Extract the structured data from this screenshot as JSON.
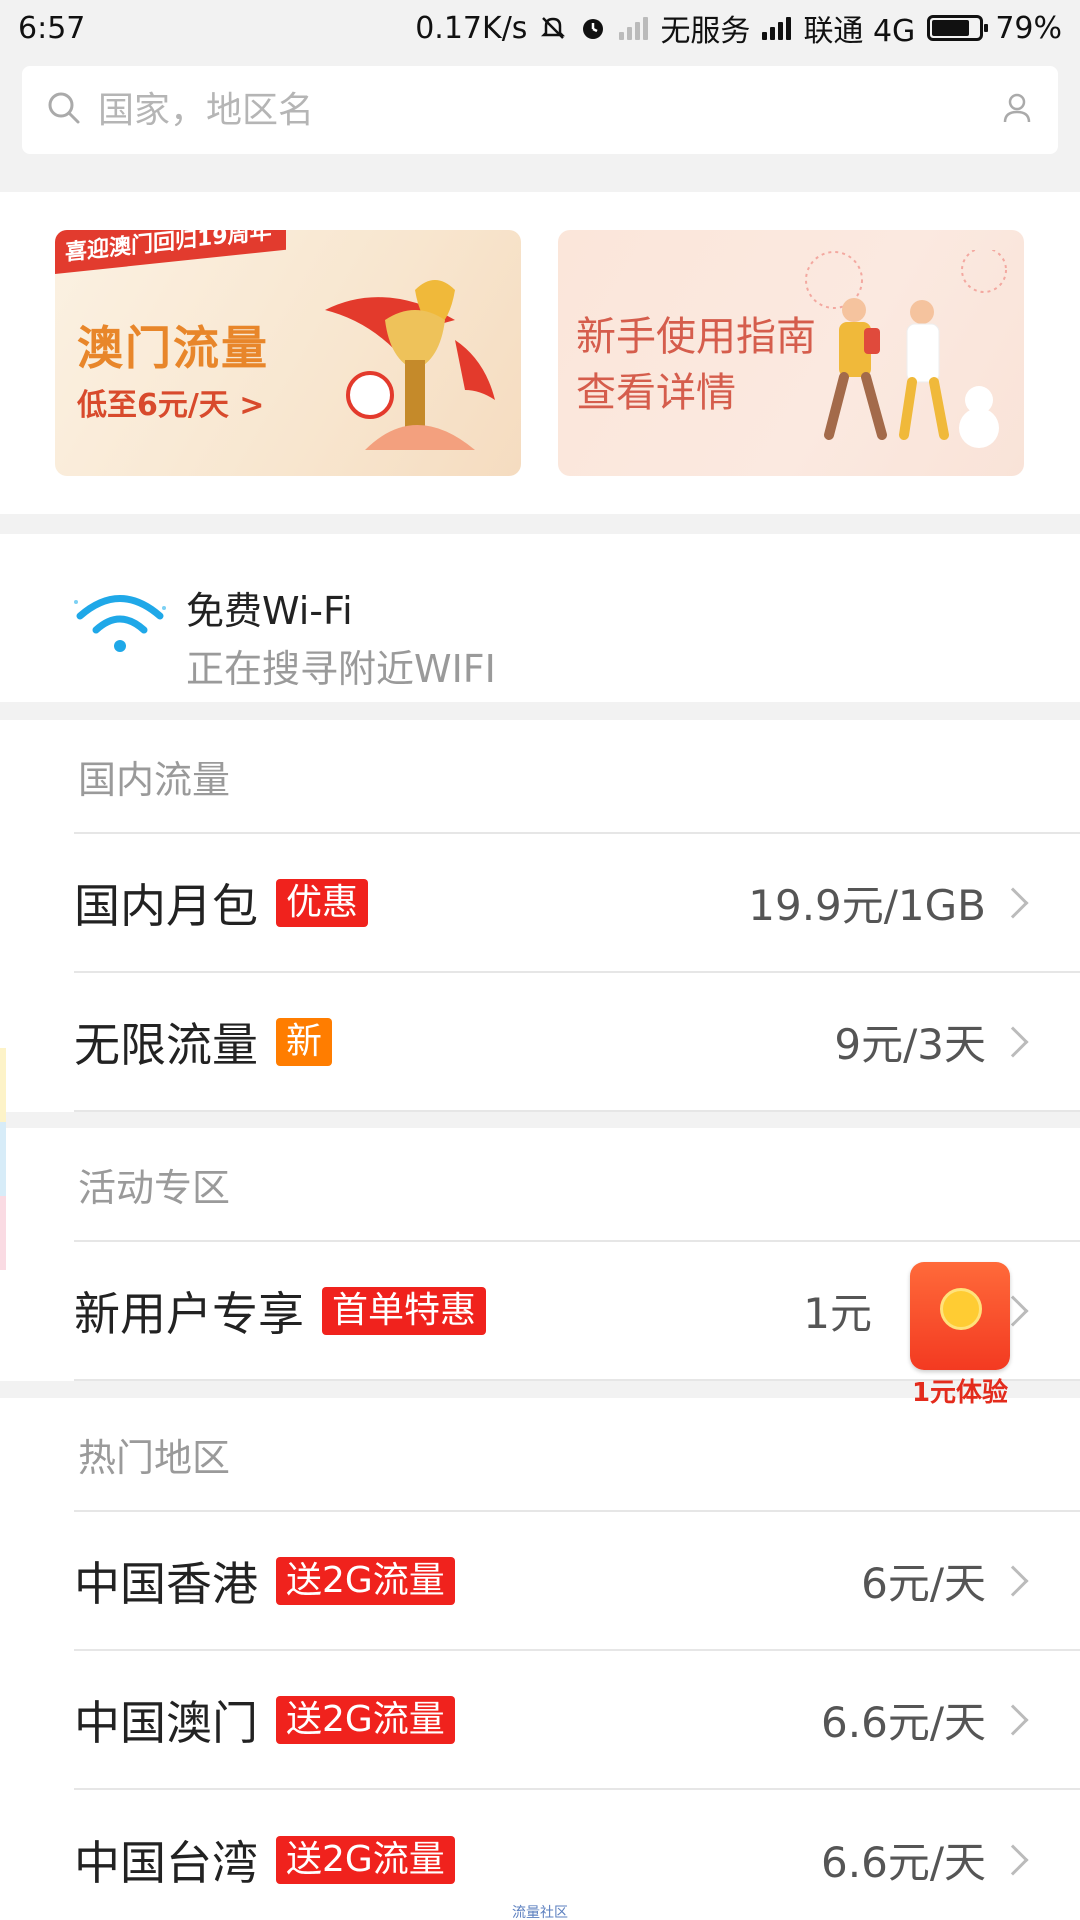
{
  "status_bar": {
    "time": "6:57",
    "speed": "0.17K/s",
    "no_service": "无服务",
    "carrier": "联通 4G",
    "battery": "79%",
    "battery_level": 0.79
  },
  "search": {
    "placeholder": "国家，地区名"
  },
  "banners": [
    {
      "ribbon": "喜迎澳门回归19周年",
      "title": "澳门流量",
      "subtitle": "低至6元/天 >"
    },
    {
      "title": "新手使用指南",
      "subtitle": "查看详情"
    }
  ],
  "wifi": {
    "title": "免费Wi-Fi",
    "status": "正在搜寻附近WIFI"
  },
  "domestic": {
    "header": "国内流量",
    "rows": [
      {
        "name": "国内月包",
        "tag": "优惠",
        "price": "19.9元/1GB"
      },
      {
        "name": "无限流量",
        "tag": "新",
        "price": "9元/3天"
      }
    ]
  },
  "activity": {
    "header": "活动专区",
    "rows": [
      {
        "name": "新用户专享",
        "tag": "首单特惠",
        "price": "1元"
      }
    ]
  },
  "popular": {
    "header": "热门地区",
    "rows": [
      {
        "name": "中国香港",
        "tag": "送2G流量",
        "price": "6元/天"
      },
      {
        "name": "中国澳门",
        "tag": "送2G流量",
        "price": "6.6元/天"
      },
      {
        "name": "中国台湾",
        "tag": "送2G流量",
        "price": "6.6元/天"
      }
    ]
  },
  "float_badge": {
    "label": "1元体验"
  },
  "footer": {
    "watermark": "流量社区"
  },
  "colors": {
    "tag_red": "#f0221d",
    "tag_orange": "#ff7d00",
    "wifi_blue": "#1fa8e8"
  }
}
